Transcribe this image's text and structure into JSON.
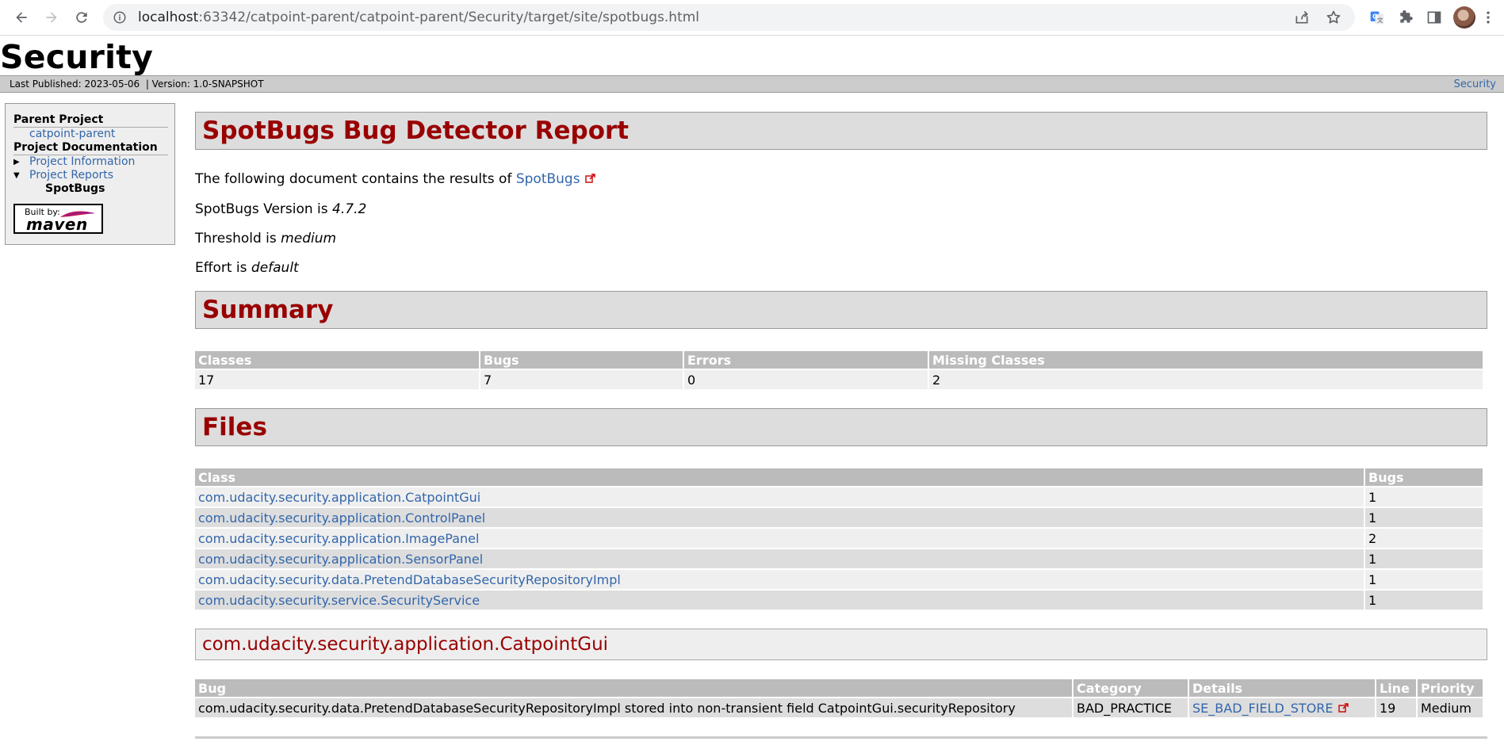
{
  "browser": {
    "url_host": "localhost",
    "url_path": ":63342/catpoint-parent/catpoint-parent/Security/target/site/spotbugs.html"
  },
  "site": {
    "title": "Security",
    "last_published": "Last Published: 2023-05-06",
    "version": "| Version: 1.0-SNAPSHOT",
    "breadcrumb_right": "Security"
  },
  "nav": {
    "parent_heading": "Parent Project",
    "parent_link": "catpoint-parent",
    "doc_heading": "Project Documentation",
    "items": [
      {
        "label": "Project Information",
        "expanded": false
      },
      {
        "label": "Project Reports",
        "expanded": true
      }
    ],
    "current": "SpotBugs",
    "badge_built": "Built by:",
    "badge_word": "maven"
  },
  "report": {
    "title": "SpotBugs Bug Detector Report",
    "intro_text": "The following document contains the results of ",
    "intro_link": "SpotBugs",
    "version_label": "SpotBugs Version is ",
    "version_value": "4.7.2",
    "threshold_label": "Threshold is ",
    "threshold_value": "medium",
    "effort_label": "Effort is ",
    "effort_value": "default"
  },
  "summary": {
    "heading": "Summary",
    "headers": [
      "Classes",
      "Bugs",
      "Errors",
      "Missing Classes"
    ],
    "values": [
      "17",
      "7",
      "0",
      "2"
    ]
  },
  "files": {
    "heading": "Files",
    "headers": [
      "Class",
      "Bugs"
    ],
    "rows": [
      {
        "class": "com.udacity.security.application.CatpointGui",
        "bugs": "1"
      },
      {
        "class": "com.udacity.security.application.ControlPanel",
        "bugs": "1"
      },
      {
        "class": "com.udacity.security.application.ImagePanel",
        "bugs": "2"
      },
      {
        "class": "com.udacity.security.application.SensorPanel",
        "bugs": "1"
      },
      {
        "class": "com.udacity.security.data.PretendDatabaseSecurityRepositoryImpl",
        "bugs": "1"
      },
      {
        "class": "com.udacity.security.service.SecurityService",
        "bugs": "1"
      }
    ]
  },
  "detail": {
    "heading": "com.udacity.security.application.CatpointGui",
    "headers": [
      "Bug",
      "Category",
      "Details",
      "Line",
      "Priority"
    ],
    "rows": [
      {
        "bug": "com.udacity.security.data.PretendDatabaseSecurityRepositoryImpl stored into non-transient field CatpointGui.securityRepository",
        "category": "BAD_PRACTICE",
        "details": "SE_BAD_FIELD_STORE",
        "line": "19",
        "priority": "Medium"
      }
    ]
  }
}
